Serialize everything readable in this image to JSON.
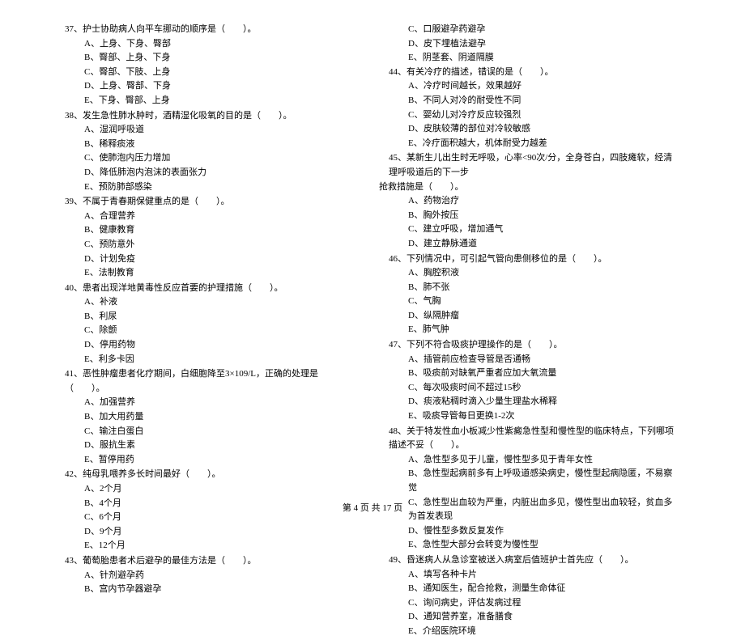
{
  "footer": "第 4 页  共 17 页",
  "left": [
    {
      "num": "37、",
      "stem": "护士协助病人向平车挪动的顺序是（　　）。",
      "opts": [
        "A、上身、下身、臀部",
        "B、臀部、上身、下身",
        "C、臀部、下肢、上身",
        "D、上身、臀部、下身",
        "E、下身、臀部、上身"
      ]
    },
    {
      "num": "38、",
      "stem": "发生急性肺水肿时，酒精湿化吸氧的目的是（　　）。",
      "opts": [
        "A、湿润呼吸道",
        "B、稀释痰液",
        "C、使肺泡内压力增加",
        "D、降低肺泡内泡沫的表面张力",
        "E、预防肺部感染"
      ]
    },
    {
      "num": "39、",
      "stem": "不属于青春期保健重点的是（　　）。",
      "opts": [
        "A、合理营养",
        "B、健康教育",
        "C、预防意外",
        "D、计划免疫",
        "E、法制教育"
      ]
    },
    {
      "num": "40、",
      "stem": "患者出现洋地黄毒性反应首要的护理措施（　　）。",
      "opts": [
        "A、补液",
        "B、利尿",
        "C、除颤",
        "D、停用药物",
        "E、利多卡因"
      ]
    },
    {
      "num": "41、",
      "stem": "恶性肿瘤患者化疗期间，白细胞降至3×109/L，正确的处理是（　　）。",
      "opts": [
        "A、加强营养",
        "B、加大用药量",
        "C、输注白蛋白",
        "D、服抗生素",
        "E、暂停用药"
      ]
    },
    {
      "num": "42、",
      "stem": "纯母乳喂养多长时间最好（　　）。",
      "opts": [
        "A、2个月",
        "B、4个月",
        "C、6个月",
        "D、9个月",
        "E、12个月"
      ]
    },
    {
      "num": "43、",
      "stem": "葡萄胎患者术后避孕的最佳方法是（　　）。",
      "opts": [
        "A、针剂避孕药",
        "B、宫内节孕器避孕"
      ]
    }
  ],
  "right_pre": [
    "C、口服避孕药避孕",
    "D、皮下埋植法避孕",
    "E、阴茎套、阴道隔膜"
  ],
  "right": [
    {
      "num": "44、",
      "stem": "有关冷疗的描述，错误的是（　　）。",
      "opts": [
        "A、冷疗时间越长，效果越好",
        "B、不同人对冷的耐受性不同",
        "C、婴幼儿对冷疗反应较强烈",
        "D、皮肤较薄的部位对冷较敏感",
        "E、冷疗面积越大，机体耐受力越差"
      ]
    },
    {
      "num": "45、",
      "stem": "某新生儿出生时无呼吸，心率<90次/分，全身苍白，四肢瘫软，经清理呼吸道后的下一步",
      "stem2": "抢救措施是（　　）。",
      "opts": [
        "A、药物治疗",
        "B、胸外按压",
        "C、建立呼吸，增加通气",
        "D、建立静脉通道"
      ]
    },
    {
      "num": "46、",
      "stem": "下列情况中，可引起气管向患侧移位的是（　　）。",
      "opts": [
        "A、胸腔积液",
        "B、肺不张",
        "C、气胸",
        "D、纵隔肿瘤",
        "E、肺气肿"
      ]
    },
    {
      "num": "47、",
      "stem": "下列不符合吸痰护理操作的是（　　）。",
      "opts": [
        "A、插管前应检查导管是否通畅",
        "B、吸痰前对缺氧严重者应加大氧流量",
        "C、每次吸痰时间不超过15秒",
        "D、痰液粘稠时滴入少量生理盐水稀释",
        "E、吸痰导管每日更换1-2次"
      ]
    },
    {
      "num": "48、",
      "stem": "关于特发性血小板减少性紫癜急性型和慢性型的临床特点，下列哪项描述不妥（　　）。",
      "opts": [
        "A、急性型多见于儿童，慢性型多见于青年女性",
        "B、急性型起病前多有上呼吸道感染病史，慢性型起病隐匿，不易察觉",
        "C、急性型出血较为严重，内脏出血多见，慢性型出血较轻，贫血多为首发表现",
        "D、慢性型多数反复发作",
        "E、急性型大部分会转变为慢性型"
      ]
    },
    {
      "num": "49、",
      "stem": "昏迷病人从急诊室被送入病室后值班护士首先应（　　）。",
      "opts": [
        "A、填写各种卡片",
        "B、通知医生，配合抢救，测量生命体征",
        "C、询问病史，评估发病过程",
        "D、通知营养室，准备膳食",
        "E、介绍医院环境"
      ]
    }
  ]
}
